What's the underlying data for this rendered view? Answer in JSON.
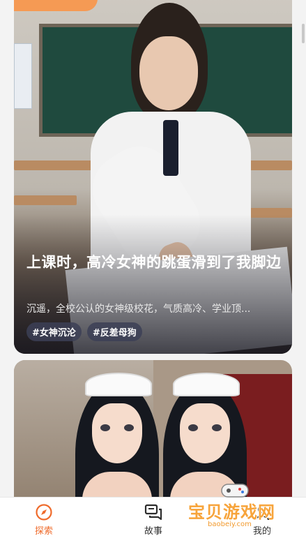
{
  "feed": {
    "cards": [
      {
        "title": "上课时，高冷女神的跳蛋滑到了我脚边",
        "description": "沉遥，全校公认的女神级校花，气质高冷、学业顶...",
        "tags": [
          "#女神沉沦",
          "#反差母狗"
        ]
      },
      {
        "title": "",
        "description": "",
        "tags": []
      }
    ]
  },
  "bottom_nav": {
    "items": [
      {
        "label": "探索",
        "icon": "compass-icon",
        "active": true
      },
      {
        "label": "故事",
        "icon": "chat-bubbles-icon",
        "active": false
      },
      {
        "label": "我的",
        "icon": "profile-icon",
        "active": false
      }
    ]
  },
  "watermark": {
    "text": "宝贝游戏网",
    "url": "baobeiy.com"
  },
  "colors": {
    "accent": "#ef6b2b",
    "tag_bg": "#3c4056"
  }
}
